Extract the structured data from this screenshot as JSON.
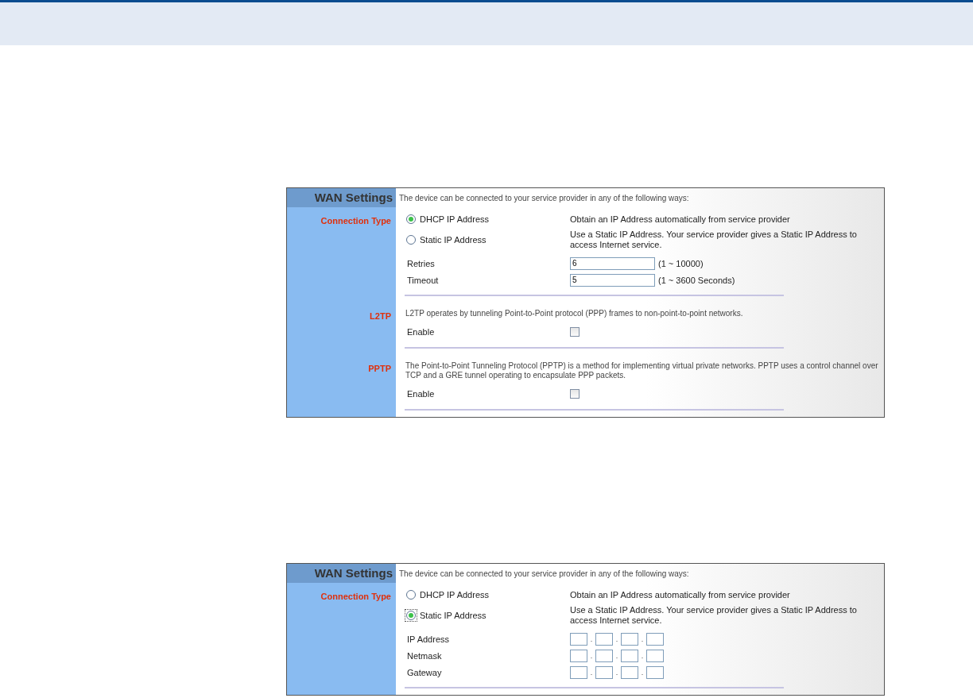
{
  "panels": [
    {
      "title": "WAN Settings",
      "intro": "The device can be connected to your service provider in any of the following ways:",
      "sections": [
        {
          "label": "Connection Type",
          "rows": [
            {
              "kind": "radio",
              "label": "DHCP IP Address",
              "selected": true,
              "focused": false,
              "description": "Obtain an IP Address automatically from service provider"
            },
            {
              "kind": "radio",
              "label": "Static IP Address",
              "selected": false,
              "focused": false,
              "description": "Use a Static IP Address. Your service provider gives a Static IP Address to access Internet service."
            },
            {
              "kind": "text",
              "label": "Retries",
              "value": "6",
              "hint": "(1 ~ 10000)"
            },
            {
              "kind": "text",
              "label": "Timeout",
              "value": "5",
              "hint": "(1 ~ 3600 Seconds)"
            }
          ]
        },
        {
          "label": "L2TP",
          "description": "L2TP operates by tunneling Point-to-Point protocol (PPP) frames to non-point-to-point networks.",
          "rows": [
            {
              "kind": "checkbox",
              "label": "Enable",
              "checked": false
            }
          ]
        },
        {
          "label": "PPTP",
          "description": "The Point-to-Point Tunneling Protocol (PPTP) is a method for implementing virtual private networks. PPTP uses a control channel over TCP and a GRE tunnel operating to encapsulate PPP packets.",
          "rows": [
            {
              "kind": "checkbox",
              "label": "Enable",
              "checked": false
            }
          ]
        }
      ]
    },
    {
      "title": "WAN Settings",
      "intro": "The device can be connected to your service provider in any of the following ways:",
      "sections": [
        {
          "label": "Connection Type",
          "rows": [
            {
              "kind": "radio",
              "label": "DHCP IP Address",
              "selected": false,
              "focused": false,
              "description": "Obtain an IP Address automatically from service provider"
            },
            {
              "kind": "radio",
              "label": "Static IP Address",
              "selected": true,
              "focused": true,
              "description": "Use a Static IP Address. Your service provider gives a Static IP Address to access Internet service."
            },
            {
              "kind": "ip",
              "label": "IP Address",
              "separators": [
                ".",
                ".",
                "."
              ]
            },
            {
              "kind": "ip",
              "label": "Netmask",
              "separators": [
                ".",
                ".",
                "."
              ]
            },
            {
              "kind": "ip",
              "label": "Gateway",
              "separators": [
                ".",
                ".",
                "."
              ]
            }
          ]
        }
      ]
    }
  ]
}
